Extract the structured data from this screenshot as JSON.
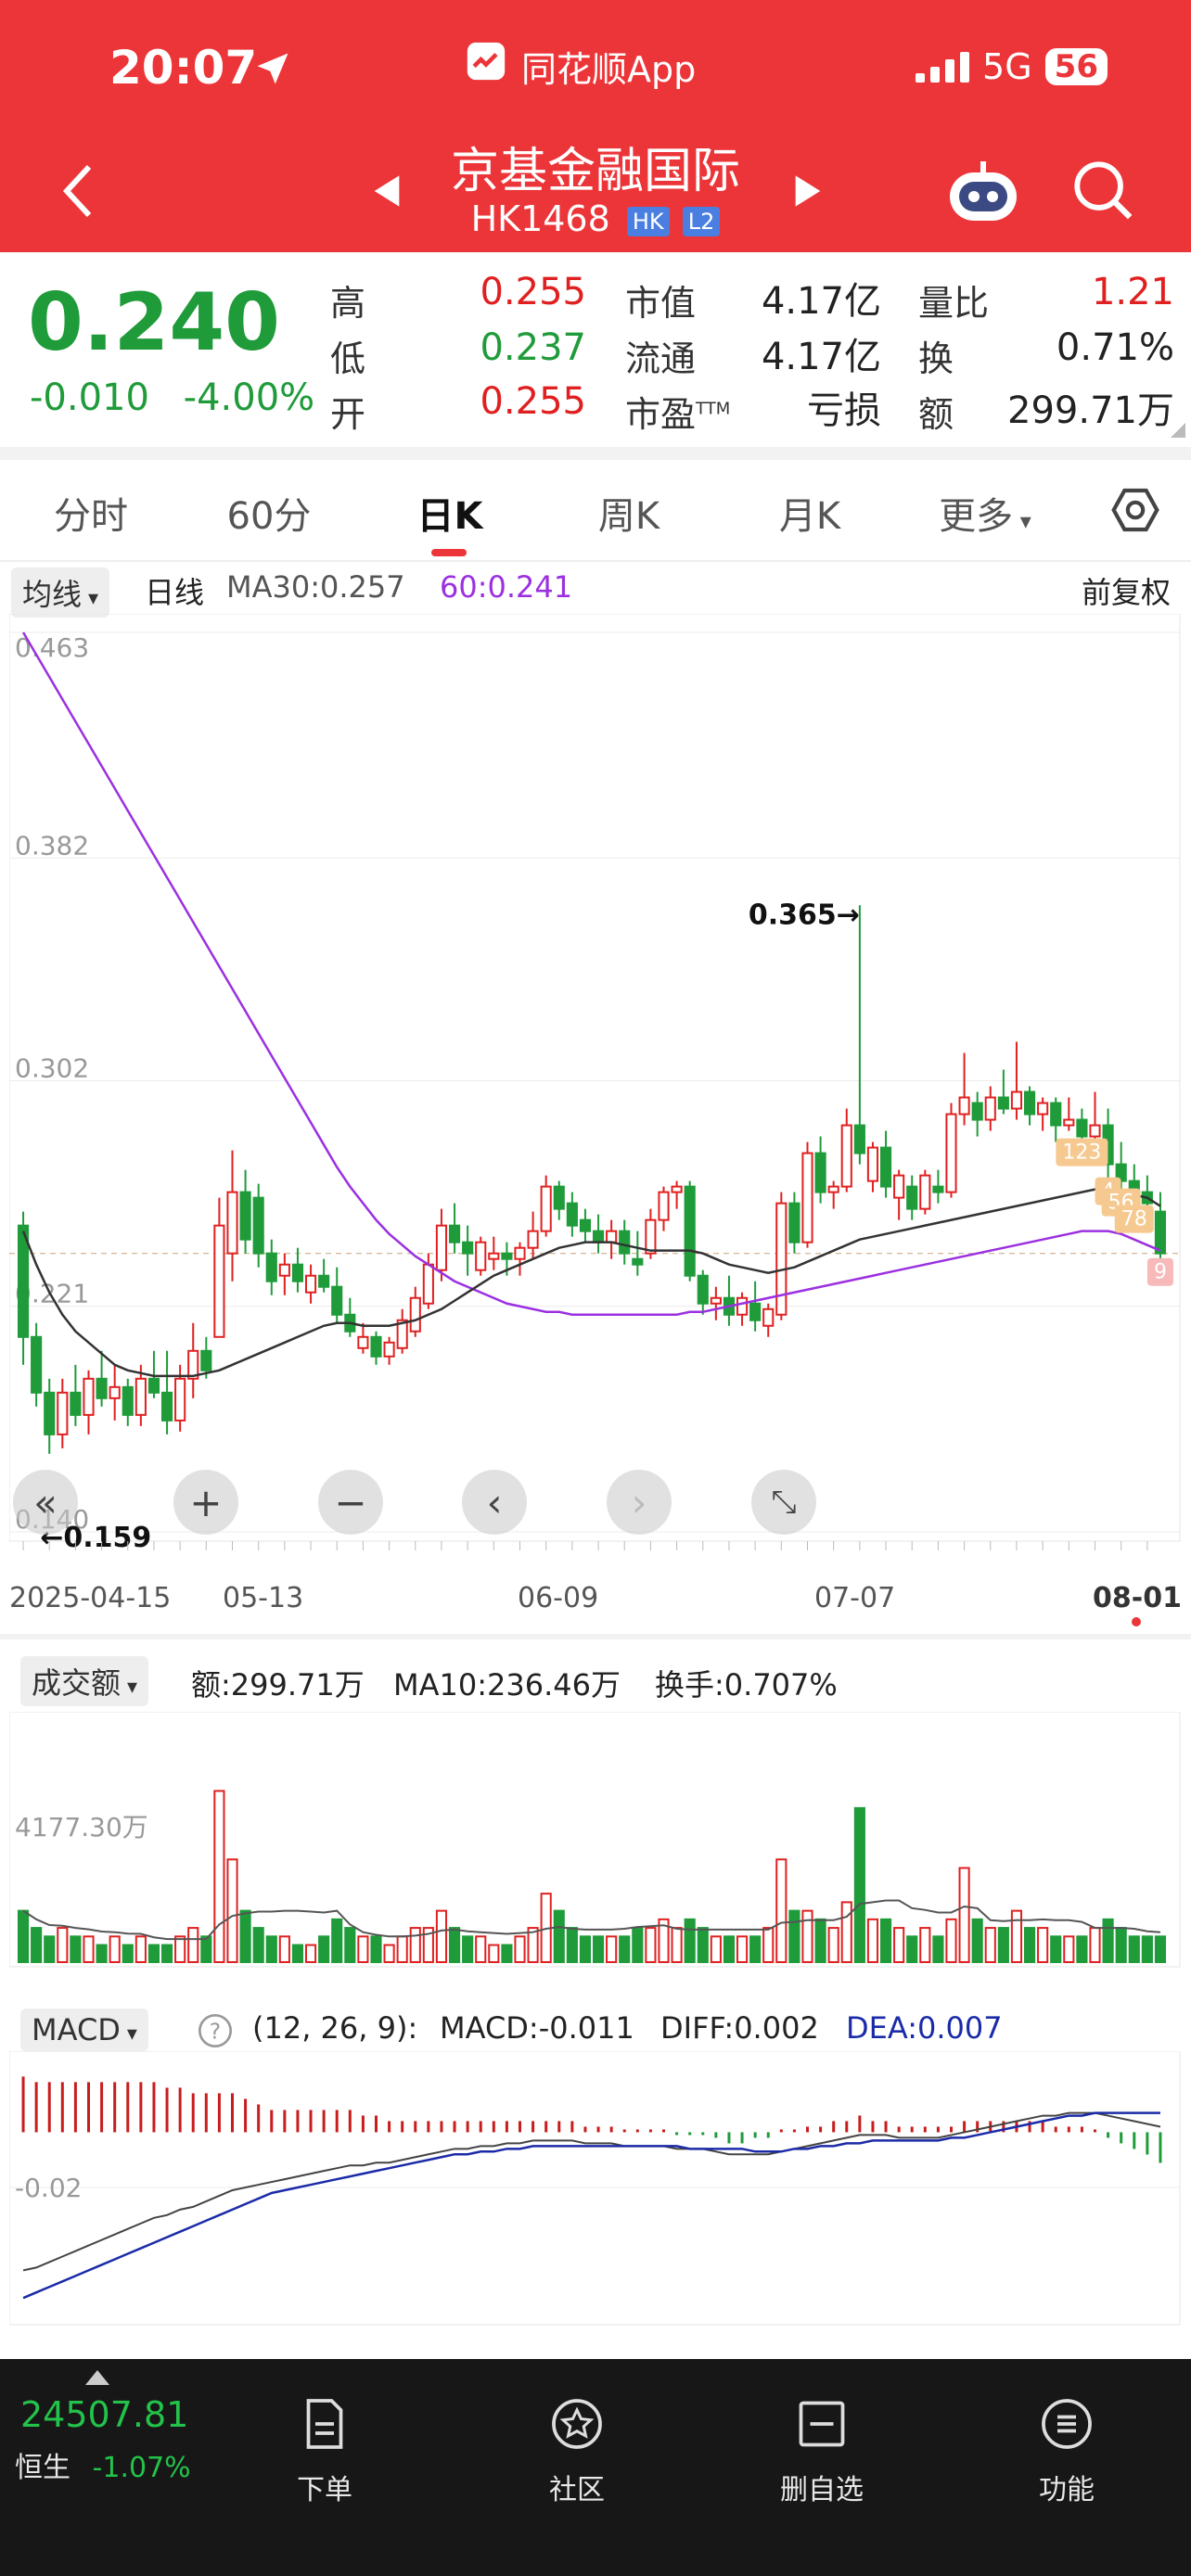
{
  "status_bar": {
    "time": "20:07",
    "app_name": "同花顺App",
    "network": "5G",
    "battery": "56"
  },
  "header": {
    "title": "京基金融国际",
    "code": "HK1468",
    "tag_market": "HK",
    "tag_level": "L2"
  },
  "quote": {
    "price": "0.240",
    "change": "-0.010",
    "change_pct": "-4.00%",
    "rows": [
      {
        "l1": "高",
        "v1": "0.255",
        "l2": "市值",
        "v2": "4.17亿",
        "l3": "量比",
        "v3": "1.21"
      },
      {
        "l1": "低",
        "v1": "0.237",
        "l2": "流通",
        "v2": "4.17亿",
        "l3": "换",
        "v3": "0.71%"
      },
      {
        "l1": "开",
        "v1": "0.255",
        "l2": "市盈",
        "l2_sup": "TTM",
        "v2": "亏损",
        "l3": "额",
        "v3": "299.71万"
      }
    ]
  },
  "tabs": [
    "分时",
    "60分",
    "日K",
    "周K",
    "月K",
    "更多"
  ],
  "active_tab": "日K",
  "kline_header": {
    "indicator": "均线",
    "period": "日线",
    "ma30": "MA30:0.257",
    "ma60": "60:0.241",
    "adjust": "前复权"
  },
  "kline_axis": {
    "y_labels": [
      "0.463",
      "0.382",
      "0.302",
      "0.221",
      "0.140"
    ],
    "x_labels": [
      "2025-04-15",
      "05-13",
      "06-09",
      "07-07",
      "08-01"
    ]
  },
  "annotations": {
    "high": "0.365→",
    "low": "←0.159",
    "badges": [
      "123",
      "4",
      "56",
      "78",
      "9"
    ]
  },
  "volume_header": {
    "indicator": "成交额",
    "amount": "额:299.71万",
    "ma10": "MA10:236.46万",
    "turnover": "换手:0.707%",
    "max_label": "4177.30万"
  },
  "macd_header": {
    "indicator": "MACD",
    "params": "(12, 26, 9):",
    "macd": "MACD:-0.011",
    "diff": "DIFF:0.002",
    "dea": "DEA:0.007",
    "axis_label": "-0.02"
  },
  "bottom_nav": {
    "index_value": "24507.81",
    "index_name": "恒生",
    "index_change": "-1.07%",
    "items": [
      "下单",
      "社区",
      "删自选",
      "功能"
    ]
  },
  "colors": {
    "up": "#e02020",
    "down": "#1f9b3a",
    "ma60": "#9b30e0",
    "ma30": "#333333",
    "dea": "#1b2ba8",
    "header": "#EC3538"
  },
  "chart_data": {
    "type": "candlestick",
    "y_range": [
      0.14,
      0.463
    ],
    "x_labels": [
      "2025-04-15",
      "05-13",
      "06-09",
      "07-07",
      "08-01"
    ],
    "ohlc": [
      [
        0.25,
        0.255,
        0.2,
        0.21
      ],
      [
        0.21,
        0.215,
        0.185,
        0.19
      ],
      [
        0.19,
        0.195,
        0.168,
        0.175
      ],
      [
        0.175,
        0.195,
        0.17,
        0.19
      ],
      [
        0.19,
        0.2,
        0.178,
        0.182
      ],
      [
        0.182,
        0.198,
        0.175,
        0.195
      ],
      [
        0.195,
        0.205,
        0.185,
        0.188
      ],
      [
        0.188,
        0.2,
        0.18,
        0.192
      ],
      [
        0.192,
        0.195,
        0.178,
        0.182
      ],
      [
        0.182,
        0.2,
        0.178,
        0.195
      ],
      [
        0.195,
        0.205,
        0.188,
        0.19
      ],
      [
        0.19,
        0.205,
        0.175,
        0.18
      ],
      [
        0.18,
        0.2,
        0.176,
        0.195
      ],
      [
        0.195,
        0.215,
        0.188,
        0.205
      ],
      [
        0.205,
        0.21,
        0.195,
        0.198
      ],
      [
        0.21,
        0.26,
        0.21,
        0.25
      ],
      [
        0.24,
        0.277,
        0.23,
        0.262
      ],
      [
        0.262,
        0.27,
        0.24,
        0.245
      ],
      [
        0.26,
        0.265,
        0.235,
        0.24
      ],
      [
        0.24,
        0.245,
        0.225,
        0.23
      ],
      [
        0.232,
        0.24,
        0.225,
        0.236
      ],
      [
        0.236,
        0.242,
        0.226,
        0.23
      ],
      [
        0.226,
        0.236,
        0.222,
        0.232
      ],
      [
        0.232,
        0.238,
        0.226,
        0.228
      ],
      [
        0.228,
        0.235,
        0.215,
        0.218
      ],
      [
        0.218,
        0.224,
        0.21,
        0.212
      ],
      [
        0.206,
        0.215,
        0.204,
        0.21
      ],
      [
        0.21,
        0.212,
        0.2,
        0.203
      ],
      [
        0.203,
        0.21,
        0.2,
        0.208
      ],
      [
        0.206,
        0.22,
        0.204,
        0.216
      ],
      [
        0.212,
        0.228,
        0.21,
        0.224
      ],
      [
        0.222,
        0.24,
        0.22,
        0.236
      ],
      [
        0.234,
        0.256,
        0.23,
        0.25
      ],
      [
        0.25,
        0.258,
        0.24,
        0.244
      ],
      [
        0.244,
        0.25,
        0.232,
        0.24
      ],
      [
        0.234,
        0.246,
        0.232,
        0.244
      ],
      [
        0.238,
        0.246,
        0.234,
        0.24
      ],
      [
        0.24,
        0.244,
        0.232,
        0.238
      ],
      [
        0.238,
        0.244,
        0.232,
        0.242
      ],
      [
        0.242,
        0.255,
        0.238,
        0.248
      ],
      [
        0.248,
        0.268,
        0.246,
        0.264
      ],
      [
        0.264,
        0.266,
        0.252,
        0.256
      ],
      [
        0.258,
        0.262,
        0.246,
        0.25
      ],
      [
        0.252,
        0.256,
        0.244,
        0.248
      ],
      [
        0.248,
        0.254,
        0.24,
        0.244
      ],
      [
        0.244,
        0.252,
        0.238,
        0.248
      ],
      [
        0.248,
        0.252,
        0.236,
        0.24
      ],
      [
        0.238,
        0.248,
        0.232,
        0.236
      ],
      [
        0.24,
        0.256,
        0.238,
        0.252
      ],
      [
        0.252,
        0.264,
        0.248,
        0.262
      ],
      [
        0.262,
        0.266,
        0.256,
        0.264
      ],
      [
        0.264,
        0.266,
        0.23,
        0.232
      ],
      [
        0.232,
        0.234,
        0.218,
        0.222
      ],
      [
        0.222,
        0.228,
        0.216,
        0.224
      ],
      [
        0.224,
        0.232,
        0.214,
        0.218
      ],
      [
        0.218,
        0.226,
        0.214,
        0.224
      ],
      [
        0.222,
        0.23,
        0.212,
        0.216
      ],
      [
        0.214,
        0.222,
        0.21,
        0.22
      ],
      [
        0.218,
        0.262,
        0.216,
        0.258
      ],
      [
        0.258,
        0.262,
        0.24,
        0.244
      ],
      [
        0.244,
        0.28,
        0.242,
        0.276
      ],
      [
        0.276,
        0.282,
        0.258,
        0.262
      ],
      [
        0.262,
        0.266,
        0.256,
        0.264
      ],
      [
        0.264,
        0.292,
        0.262,
        0.286
      ],
      [
        0.286,
        0.365,
        0.272,
        0.276
      ],
      [
        0.266,
        0.28,
        0.262,
        0.278
      ],
      [
        0.278,
        0.284,
        0.26,
        0.264
      ],
      [
        0.26,
        0.27,
        0.252,
        0.268
      ],
      [
        0.264,
        0.268,
        0.252,
        0.256
      ],
      [
        0.256,
        0.27,
        0.254,
        0.268
      ],
      [
        0.264,
        0.27,
        0.258,
        0.262
      ],
      [
        0.262,
        0.294,
        0.26,
        0.29
      ],
      [
        0.29,
        0.312,
        0.286,
        0.296
      ],
      [
        0.294,
        0.298,
        0.282,
        0.288
      ],
      [
        0.288,
        0.3,
        0.284,
        0.296
      ],
      [
        0.296,
        0.306,
        0.29,
        0.292
      ],
      [
        0.292,
        0.316,
        0.288,
        0.298
      ],
      [
        0.298,
        0.3,
        0.286,
        0.29
      ],
      [
        0.29,
        0.296,
        0.284,
        0.294
      ],
      [
        0.294,
        0.296,
        0.28,
        0.286
      ],
      [
        0.286,
        0.296,
        0.284,
        0.288
      ],
      [
        0.288,
        0.292,
        0.28,
        0.282
      ],
      [
        0.282,
        0.298,
        0.28,
        0.286
      ],
      [
        0.286,
        0.292,
        0.266,
        0.272
      ],
      [
        0.272,
        0.28,
        0.262,
        0.266
      ],
      [
        0.266,
        0.272,
        0.256,
        0.262
      ],
      [
        0.262,
        0.268,
        0.252,
        0.258
      ],
      [
        0.255,
        0.262,
        0.237,
        0.24
      ]
    ],
    "ma30": [
      0.248,
      0.236,
      0.226,
      0.218,
      0.212,
      0.208,
      0.204,
      0.2,
      0.198,
      0.197,
      0.196,
      0.196,
      0.196,
      0.196,
      0.197,
      0.198,
      0.2,
      0.202,
      0.204,
      0.206,
      0.208,
      0.21,
      0.212,
      0.214,
      0.215,
      0.215,
      0.214,
      0.214,
      0.214,
      0.215,
      0.216,
      0.218,
      0.22,
      0.223,
      0.226,
      0.229,
      0.232,
      0.234,
      0.236,
      0.238,
      0.24,
      0.242,
      0.243,
      0.244,
      0.244,
      0.244,
      0.243,
      0.242,
      0.241,
      0.241,
      0.241,
      0.241,
      0.24,
      0.238,
      0.236,
      0.235,
      0.234,
      0.233,
      0.234,
      0.235,
      0.237,
      0.239,
      0.241,
      0.243,
      0.245,
      0.246,
      0.247,
      0.248,
      0.249,
      0.25,
      0.251,
      0.252,
      0.253,
      0.254,
      0.255,
      0.256,
      0.257,
      0.258,
      0.259,
      0.26,
      0.261,
      0.262,
      0.263,
      0.263,
      0.262,
      0.261,
      0.26,
      0.257
    ],
    "ma60": [
      0.463,
      0.455,
      0.447,
      0.439,
      0.431,
      0.423,
      0.415,
      0.407,
      0.399,
      0.391,
      0.383,
      0.375,
      0.367,
      0.359,
      0.351,
      0.343,
      0.335,
      0.327,
      0.319,
      0.311,
      0.303,
      0.295,
      0.287,
      0.279,
      0.271,
      0.264,
      0.258,
      0.252,
      0.247,
      0.243,
      0.239,
      0.236,
      0.233,
      0.23,
      0.228,
      0.226,
      0.224,
      0.222,
      0.221,
      0.22,
      0.219,
      0.219,
      0.218,
      0.218,
      0.218,
      0.218,
      0.218,
      0.218,
      0.218,
      0.218,
      0.218,
      0.219,
      0.219,
      0.22,
      0.221,
      0.222,
      0.223,
      0.224,
      0.225,
      0.226,
      0.227,
      0.228,
      0.229,
      0.23,
      0.231,
      0.232,
      0.233,
      0.234,
      0.235,
      0.236,
      0.237,
      0.238,
      0.239,
      0.24,
      0.241,
      0.242,
      0.243,
      0.244,
      0.245,
      0.246,
      0.247,
      0.248,
      0.248,
      0.248,
      0.247,
      0.245,
      0.243,
      0.241
    ],
    "volume": [
      0.6,
      0.4,
      0.3,
      0.4,
      0.3,
      0.3,
      0.2,
      0.3,
      0.2,
      0.3,
      0.2,
      0.2,
      0.3,
      0.4,
      0.3,
      2.0,
      1.2,
      0.6,
      0.4,
      0.3,
      0.3,
      0.2,
      0.2,
      0.3,
      0.5,
      0.4,
      0.3,
      0.3,
      0.2,
      0.3,
      0.4,
      0.4,
      0.6,
      0.4,
      0.3,
      0.3,
      0.2,
      0.2,
      0.3,
      0.4,
      0.8,
      0.6,
      0.4,
      0.3,
      0.3,
      0.3,
      0.3,
      0.4,
      0.4,
      0.5,
      0.4,
      0.5,
      0.4,
      0.3,
      0.3,
      0.3,
      0.3,
      0.4,
      1.2,
      0.6,
      0.6,
      0.5,
      0.4,
      0.7,
      1.8,
      0.5,
      0.5,
      0.4,
      0.3,
      0.4,
      0.3,
      0.5,
      1.1,
      0.5,
      0.4,
      0.4,
      0.6,
      0.4,
      0.4,
      0.3,
      0.3,
      0.3,
      0.4,
      0.5,
      0.4,
      0.3,
      0.3,
      0.3
    ],
    "diff": [
      -0.05,
      -0.049,
      -0.047,
      -0.045,
      -0.043,
      -0.041,
      -0.039,
      -0.037,
      -0.035,
      -0.033,
      -0.031,
      -0.03,
      -0.028,
      -0.027,
      -0.025,
      -0.023,
      -0.021,
      -0.02,
      -0.019,
      -0.018,
      -0.017,
      -0.016,
      -0.015,
      -0.014,
      -0.013,
      -0.012,
      -0.012,
      -0.011,
      -0.011,
      -0.01,
      -0.009,
      -0.008,
      -0.007,
      -0.006,
      -0.006,
      -0.005,
      -0.005,
      -0.004,
      -0.004,
      -0.003,
      -0.003,
      -0.003,
      -0.003,
      -0.004,
      -0.004,
      -0.004,
      -0.005,
      -0.005,
      -0.005,
      -0.005,
      -0.006,
      -0.006,
      -0.006,
      -0.007,
      -0.008,
      -0.008,
      -0.008,
      -0.008,
      -0.007,
      -0.006,
      -0.005,
      -0.004,
      -0.003,
      -0.002,
      -0.001,
      -0.001,
      -0.001,
      -0.002,
      -0.002,
      -0.002,
      -0.002,
      -0.001,
      0.0,
      0.001,
      0.002,
      0.003,
      0.004,
      0.005,
      0.006,
      0.006,
      0.007,
      0.007,
      0.007,
      0.006,
      0.005,
      0.004,
      0.003,
      0.002
    ],
    "dea": [
      -0.06,
      -0.058,
      -0.056,
      -0.054,
      -0.052,
      -0.05,
      -0.048,
      -0.046,
      -0.044,
      -0.042,
      -0.04,
      -0.038,
      -0.036,
      -0.034,
      -0.032,
      -0.03,
      -0.028,
      -0.026,
      -0.024,
      -0.022,
      -0.021,
      -0.02,
      -0.019,
      -0.018,
      -0.017,
      -0.016,
      -0.015,
      -0.014,
      -0.013,
      -0.012,
      -0.011,
      -0.01,
      -0.009,
      -0.008,
      -0.008,
      -0.007,
      -0.007,
      -0.006,
      -0.006,
      -0.005,
      -0.005,
      -0.005,
      -0.005,
      -0.005,
      -0.005,
      -0.005,
      -0.005,
      -0.005,
      -0.005,
      -0.005,
      -0.005,
      -0.006,
      -0.006,
      -0.006,
      -0.006,
      -0.006,
      -0.007,
      -0.007,
      -0.007,
      -0.006,
      -0.006,
      -0.005,
      -0.005,
      -0.004,
      -0.004,
      -0.003,
      -0.003,
      -0.003,
      -0.003,
      -0.003,
      -0.003,
      -0.002,
      -0.002,
      -0.001,
      0.0,
      0.001,
      0.002,
      0.003,
      0.004,
      0.005,
      0.006,
      0.006,
      0.007,
      0.007,
      0.007,
      0.007,
      0.007,
      0.007
    ],
    "macd_hist": [
      0.02,
      0.018,
      0.018,
      0.018,
      0.018,
      0.018,
      0.018,
      0.018,
      0.018,
      0.018,
      0.018,
      0.016,
      0.016,
      0.014,
      0.014,
      0.014,
      0.014,
      0.012,
      0.01,
      0.008,
      0.008,
      0.008,
      0.008,
      0.008,
      0.008,
      0.008,
      0.006,
      0.006,
      0.004,
      0.004,
      0.004,
      0.004,
      0.004,
      0.004,
      0.004,
      0.004,
      0.004,
      0.004,
      0.004,
      0.004,
      0.004,
      0.004,
      0.004,
      0.002,
      0.002,
      0.002,
      0.001,
      0.001,
      0.001,
      0.001,
      -0.001,
      -0.001,
      -0.001,
      -0.002,
      -0.004,
      -0.004,
      -0.002,
      -0.002,
      0.001,
      0.001,
      0.002,
      0.002,
      0.004,
      0.004,
      0.006,
      0.004,
      0.004,
      0.002,
      0.002,
      0.002,
      0.002,
      0.002,
      0.004,
      0.004,
      0.004,
      0.004,
      0.004,
      0.004,
      0.004,
      0.002,
      0.002,
      0.002,
      0.001,
      -0.002,
      -0.004,
      -0.006,
      -0.008,
      -0.011
    ]
  }
}
